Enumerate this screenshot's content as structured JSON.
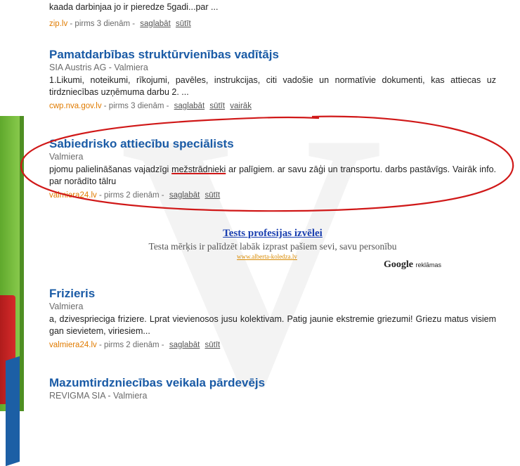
{
  "background": {
    "mark": "V"
  },
  "jobs": [
    {
      "title": "",
      "company": "",
      "desc": "kaada darbinjaa jo ir pieredze 5gadi...par ...",
      "source": "zip.lv",
      "age": "- pirms 3 dienām -",
      "actions": [
        "saglabāt",
        "sūtīt"
      ]
    },
    {
      "title": "Pamatdarbības struktūrvienības vadītājs",
      "company": "SIA Austris AG - Valmiera",
      "desc": "1.Likumi, noteikumi, rīkojumi, pavēles, instrukcijas, citi vadošie un normatīvie dokumenti, kas attiecas uz tirdzniecības uzņēmuma darbu 2. ...",
      "source": "cwp.nva.gov.lv",
      "age": "- pirms 3 dienām -",
      "actions": [
        "saglabāt",
        "sūtīt",
        "vairāk"
      ]
    },
    {
      "title": "Sabiedrisko attiecību speciālists",
      "company": "Valmiera",
      "desc_before": "pjomu palielināšanas vajadzīgi ",
      "desc_highlight": "mežstrādnieki",
      "desc_after": " ar palīgiem. ar savu zāģi un transportu. darbs pastāvīgs. Vairāk info. par norādīto tālru",
      "source": "valmiera24.lv",
      "age": "- pirms 2 dienām -",
      "actions": [
        "saglabāt",
        "sūtīt"
      ]
    },
    {
      "title": "Frizieris",
      "company": "Valmiera",
      "desc": "a, dzivesprieciga friziere. Lprat vievienosos jusu kolektivam. Patig jaunie ekstremie griezumi! Griezu matus visiem gan sievietem, viriesiem...",
      "source": "valmiera24.lv",
      "age": "- pirms 2 dienām -",
      "actions": [
        "saglabāt",
        "sūtīt"
      ]
    },
    {
      "title": "Mazumtirdzniecības veikala pārdevējs",
      "company": "REVIGMA SIA - Valmiera"
    }
  ],
  "ad": {
    "title": "Tests profesijas izvēlei",
    "text": "Testa mērķis ir palīdzēt labāk izprast pašiem sevi, savu personību",
    "url": "www.alberta-koledza.lv",
    "google": "Google",
    "google_suffix": "reklāmas"
  },
  "colors": {
    "title": "#1a5ba6",
    "source": "#e07b00",
    "highlight_ellipse": "#d01818",
    "banner": "#7dc143"
  }
}
